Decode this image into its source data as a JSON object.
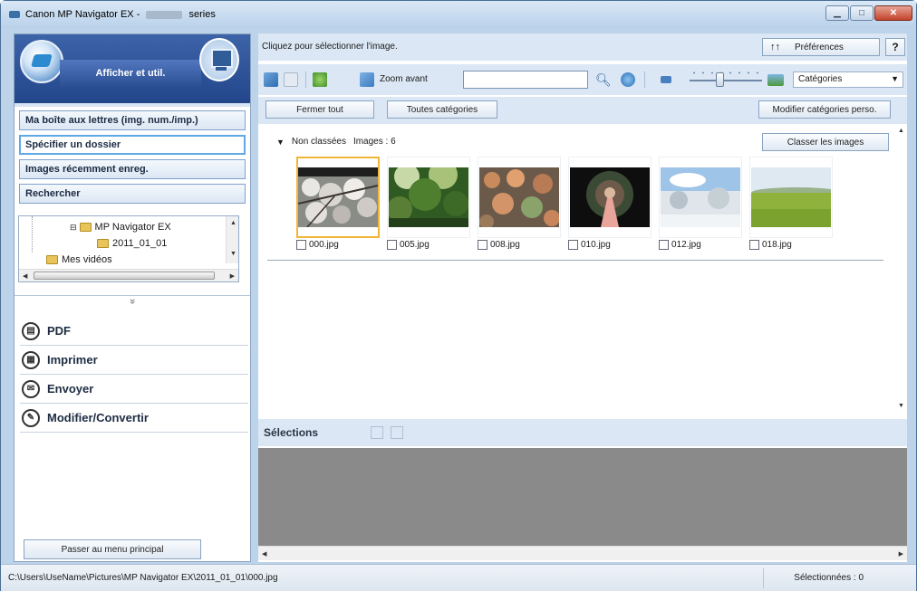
{
  "window": {
    "title_prefix": "Canon MP Navigator EX - ",
    "title_suffix": " series"
  },
  "sidebar": {
    "header_label": "Afficher et util.",
    "nav_items": [
      {
        "label": "Ma boîte aux lettres (img. num./imp.)",
        "active": false
      },
      {
        "label": "Spécifier un dossier",
        "active": true
      },
      {
        "label": "Images récemment enreg.",
        "active": false
      },
      {
        "label": "Rechercher",
        "active": false
      }
    ],
    "tree": {
      "node_parent": "MP Navigator EX",
      "node_child": "2011_01_01",
      "node_next": "Mes vidéos"
    },
    "collapse_glyph": "»",
    "actions": [
      {
        "label": "PDF",
        "icon": "pdf-icon"
      },
      {
        "label": "Imprimer",
        "icon": "print-icon"
      },
      {
        "label": "Envoyer",
        "icon": "mail-icon"
      },
      {
        "label": "Modifier/Convertir",
        "icon": "edit-icon"
      }
    ],
    "main_menu_button": "Passer au menu principal"
  },
  "main": {
    "instruction": "Cliquez pour sélectionner l'image.",
    "preferences_label": "Préférences",
    "help_label": "?",
    "zoom_label": "Zoom avant",
    "search_value": "",
    "category_select": "Catégories",
    "close_all": "Fermer tout",
    "all_categories": "Toutes catégories",
    "edit_categories": "Modifier catégories perso.",
    "classify_button": "Classer les images",
    "group": {
      "name": "Non classées",
      "count_label": "Images : 6"
    },
    "images": [
      {
        "name": "000.jpg",
        "selected": true,
        "kind": "cherry"
      },
      {
        "name": "005.jpg",
        "selected": false,
        "kind": "forest"
      },
      {
        "name": "008.jpg",
        "selected": false,
        "kind": "leaves"
      },
      {
        "name": "010.jpg",
        "selected": false,
        "kind": "tunnel"
      },
      {
        "name": "012.jpg",
        "selected": false,
        "kind": "snow"
      },
      {
        "name": "018.jpg",
        "selected": false,
        "kind": "field"
      }
    ],
    "selections_label": "Sélections"
  },
  "status": {
    "path": "C:\\Users\\UseName\\Pictures\\MP Navigator EX\\2011_01_01\\000.jpg",
    "selected_count": "Sélectionnées : 0"
  },
  "colors": {
    "accent": "#23468b",
    "selection_border": "#f2b636",
    "panel_bg": "#dbe7f4"
  }
}
